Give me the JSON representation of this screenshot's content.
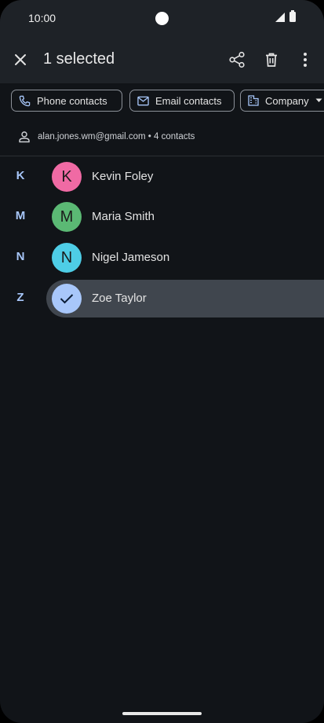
{
  "status_bar": {
    "time": "10:00"
  },
  "top_bar": {
    "title": "1 selected"
  },
  "filters": [
    {
      "label": "Phone contacts",
      "icon": "phone-icon"
    },
    {
      "label": "Email contacts",
      "icon": "email-icon"
    },
    {
      "label": "Company",
      "icon": "building-icon"
    }
  ],
  "account": {
    "text": "alan.jones.wm@gmail.com • 4 contacts"
  },
  "contacts": [
    {
      "letter": "K",
      "initial": "K",
      "name": "Kevin Foley",
      "color": "#f06aa4",
      "selected": false
    },
    {
      "letter": "M",
      "initial": "M",
      "name": "Maria Smith",
      "color": "#5bb974",
      "selected": false
    },
    {
      "letter": "N",
      "initial": "N",
      "name": "Nigel Jameson",
      "color": "#4ecde6",
      "selected": false
    },
    {
      "letter": "Z",
      "initial": "",
      "name": "Zoe Taylor",
      "color": "#a8c7fa",
      "selected": true
    }
  ],
  "colors": {
    "accent": "#a8c7fa",
    "surface": "#1e2227",
    "background": "#111418",
    "selected_row": "#40464e"
  }
}
